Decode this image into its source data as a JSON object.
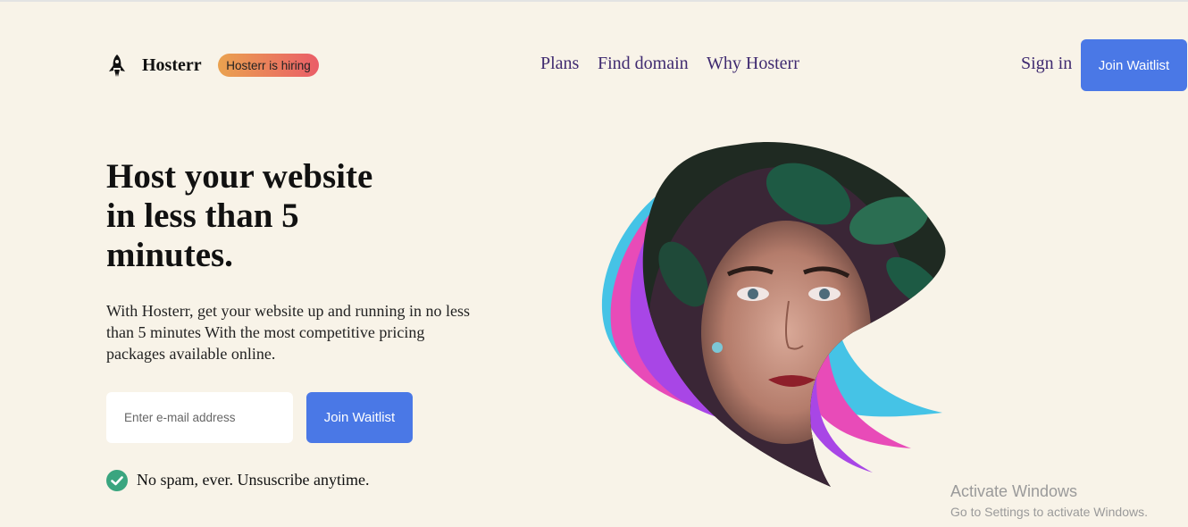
{
  "header": {
    "brand": "Hosterr",
    "hiring_badge": "Hosterr is hiring",
    "nav": [
      "Plans",
      "Find domain",
      "Why Hosterr"
    ],
    "sign_in": "Sign in",
    "cta": "Join Waitlist"
  },
  "hero": {
    "headline": "Host your website in less than 5 minutes.",
    "subtext": "With Hosterr, get your website up and running in no less than 5 minutes With the most competitive pricing packages available online.",
    "email_placeholder": "Enter e-mail address",
    "cta": "Join Waitlist",
    "note": "No spam, ever. Unsuscribe anytime."
  },
  "watermark": {
    "title": "Activate Windows",
    "subtitle": "Go to Settings to activate Windows."
  },
  "icons": {
    "logo": "rocket-icon",
    "check": "check-circle-icon"
  },
  "colors": {
    "background": "#f8f3e8",
    "accent": "#4a78e6",
    "nav_text": "#3f2a70",
    "check": "#3aa57f",
    "art_cyan": "#45c3e6",
    "art_pink": "#e84bb8",
    "art_purple": "#a846e6"
  }
}
